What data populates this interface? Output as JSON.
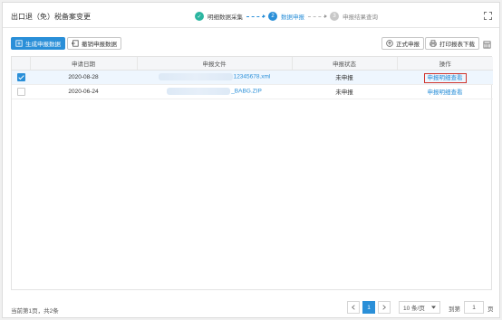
{
  "header": {
    "title": "出口退（免）税备案变更",
    "steps": [
      {
        "index": "✓",
        "label": "明细数据采集",
        "state": "done"
      },
      {
        "index": "2",
        "label": "数据申报",
        "state": "active"
      },
      {
        "index": "3",
        "label": "申报结果查询",
        "state": "todo"
      }
    ]
  },
  "toolbar": {
    "generate_label": "生成申报数据",
    "revoke_label": "撤销申报数据",
    "formal_label": "正式申报",
    "print_label": "打印报表下载"
  },
  "table": {
    "headers": [
      "申请日期",
      "申报文件",
      "申报状态",
      "操作"
    ],
    "rows": [
      {
        "checked": true,
        "date": "2020-08-28",
        "file": "12345678.xml",
        "status": "未申报",
        "action": "申报明细查看"
      },
      {
        "checked": false,
        "date": "2020-06-24",
        "file": "_BABG.ZIP",
        "status": "未申报",
        "action": "申报明细查看"
      }
    ]
  },
  "footer": {
    "info": "当前第1页，共2条",
    "current_page": "1",
    "page_size": "10 条/页",
    "goto_label": "到第",
    "goto_value": "1",
    "page_suffix": "页"
  }
}
